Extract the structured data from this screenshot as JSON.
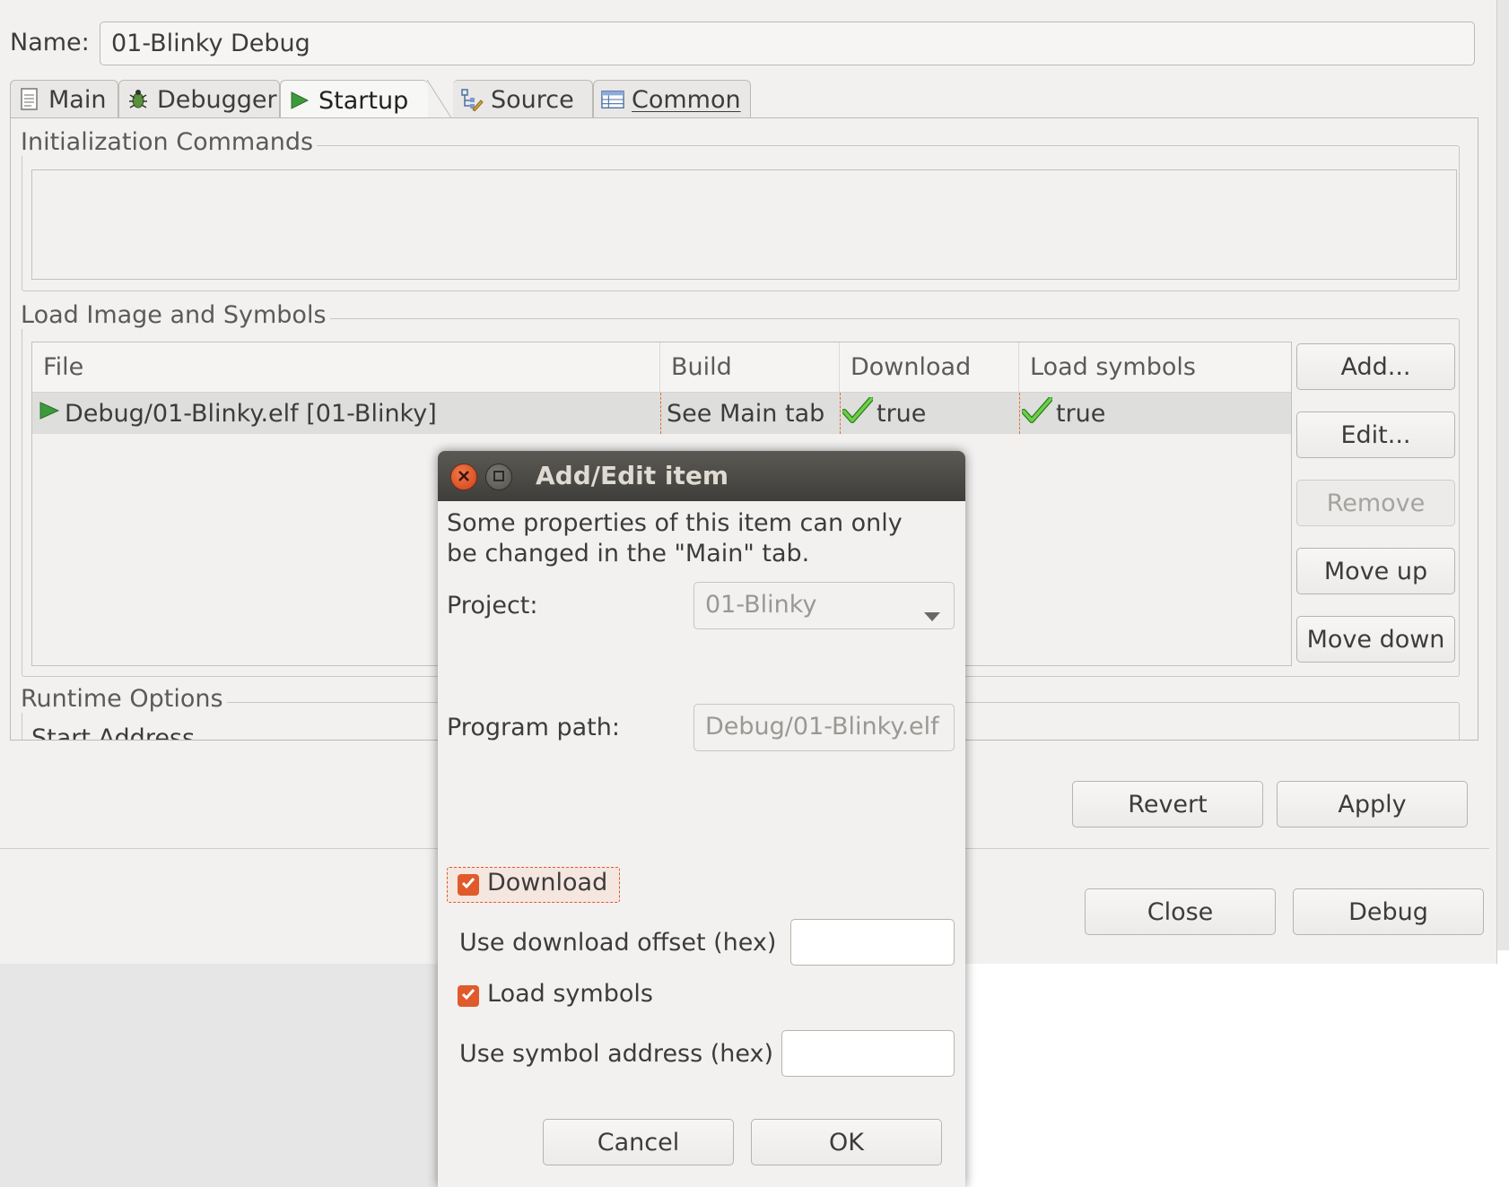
{
  "form": {
    "name_label": "Name:",
    "name_value": "01-Blinky Debug"
  },
  "tabs": [
    {
      "label": "Main",
      "icon": "document-icon"
    },
    {
      "label": "Debugger",
      "icon": "bug-icon"
    },
    {
      "label": "Startup",
      "icon": "play-icon"
    },
    {
      "label": "Source",
      "icon": "source-icon"
    },
    {
      "label": "Common",
      "icon": "table-icon"
    }
  ],
  "startup": {
    "init_title": "Initialization Commands",
    "load_title": "Load Image and Symbols",
    "runtime_title": "Runtime Options",
    "runtime_partial": "Start Address",
    "columns": [
      "File",
      "Build",
      "Download",
      "Load symbols"
    ],
    "rows": [
      {
        "file": "Debug/01-Blinky.elf [01-Blinky]",
        "build": "See Main tab",
        "download": "true",
        "load_symbols": "true"
      }
    ],
    "buttons": {
      "add": "Add...",
      "edit": "Edit...",
      "remove": "Remove",
      "move_up": "Move up",
      "move_down": "Move down"
    }
  },
  "footer": {
    "revert": "Revert",
    "apply": "Apply",
    "close": "Close",
    "debug": "Debug"
  },
  "dialog": {
    "title": "Add/Edit item",
    "message_line1": "Some properties of this item can only",
    "message_line2": "be changed in the \"Main\" tab.",
    "project_label": "Project:",
    "project_value": "01-Blinky",
    "program_label": "Program path:",
    "program_value": "Debug/01-Blinky.elf",
    "download_label": "Download",
    "download_checked": true,
    "download_offset_label": "Use download offset (hex)",
    "load_symbols_label": "Load symbols",
    "load_symbols_checked": true,
    "symbol_address_label": "Use symbol address (hex)",
    "cancel": "Cancel",
    "ok": "OK"
  },
  "colors": {
    "accent": "#e05a2b",
    "check": "#4caf2a",
    "titlebar": "#4a4945"
  }
}
